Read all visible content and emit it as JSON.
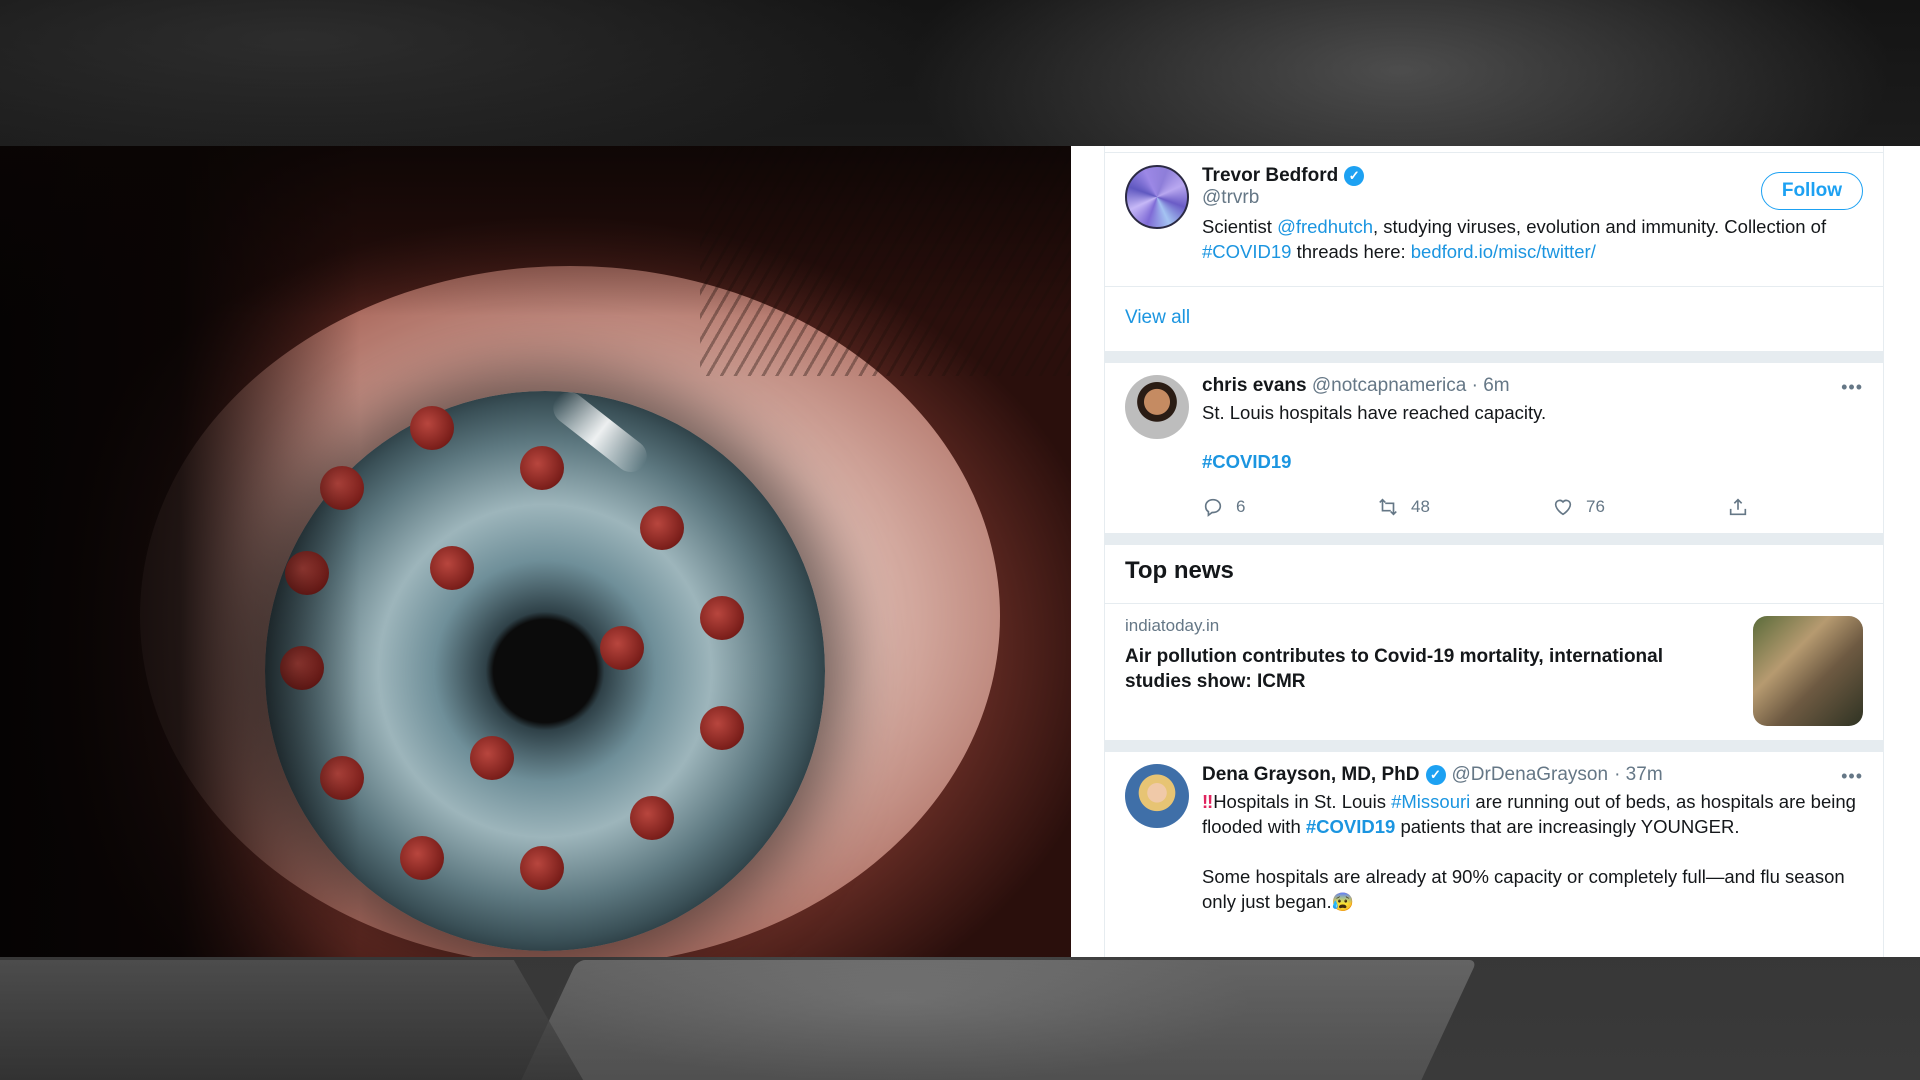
{
  "follow_card": {
    "name": "Trevor Bedford",
    "handle": "@trvrb",
    "follow_label": "Follow",
    "bio_prefix": "Scientist ",
    "bio_mention": "@fredhutch",
    "bio_middle": ", studying viruses, evolution and immunity. Collection of ",
    "bio_hashtag": "#COVID19",
    "bio_middle2": " threads here: ",
    "bio_link": "bedford.io/misc/twitter/"
  },
  "view_all_label": "View all",
  "tweet1": {
    "name": "chris evans",
    "handle": "@notcapnamerica",
    "time": "· 6m",
    "text": "St. Louis hospitals have reached capacity.",
    "hashtag": "#COVID19",
    "replies": "6",
    "retweets": "48",
    "likes": "76",
    "more": "•••"
  },
  "top_news": {
    "title": "Top news",
    "source": "indiatoday.in",
    "headline": "Air pollution contributes to Covid-19 mortality, international studies show: ICMR"
  },
  "tweet2": {
    "name": "Dena Grayson, MD, PhD",
    "handle": "@DrDenaGrayson",
    "time": "· 37m",
    "bang": "‼",
    "p1_a": "Hospitals in St. Louis ",
    "p1_tag1": "#Missouri",
    "p1_b": " are running out of beds, as hospitals are being flooded with ",
    "p1_tag2": "#COVID19",
    "p1_c": " patients that are increasingly YOUNGER.",
    "p2": "Some hospitals are already at 90% capacity or completely full—and flu season only just began.",
    "emoji": "😰",
    "more": "•••"
  },
  "icons": {
    "verified": "verified-badge-icon",
    "reply": "reply-icon",
    "retweet": "retweet-icon",
    "like": "heart-icon",
    "share": "share-icon"
  },
  "colors": {
    "link": "#1b95e0",
    "verified": "#1da1f2",
    "separator": "#e6ecf0"
  }
}
